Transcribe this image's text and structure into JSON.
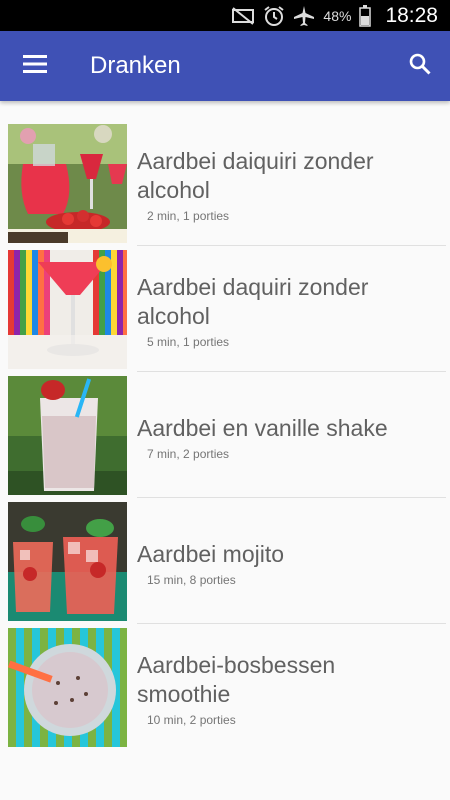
{
  "status_bar": {
    "battery_percent": "48%",
    "time": "18:28",
    "icons": [
      "mute-icon",
      "alarm-icon",
      "airplane-icon",
      "battery-icon"
    ]
  },
  "app_bar": {
    "title": "Dranken",
    "menu_icon": "hamburger-menu-icon",
    "search_icon": "search-icon",
    "color": "#3f51b5"
  },
  "recipes": [
    {
      "title_line1": "Aardbei daiquiri zonder",
      "title_line2": "alcohol",
      "meta": "2 min, 1 porties"
    },
    {
      "title_line1": "Aardbei daquiri zonder",
      "title_line2": "alcohol",
      "meta": "5 min, 1 porties"
    },
    {
      "title_line1": "Aardbei en vanille shake",
      "title_line2": "",
      "meta": "7 min, 2 porties"
    },
    {
      "title_line1": "Aardbei mojito",
      "title_line2": "",
      "meta": "15 min, 8 porties"
    },
    {
      "title_line1": "Aardbei-bosbessen",
      "title_line2": "smoothie",
      "meta": "10 min, 2 porties"
    }
  ]
}
